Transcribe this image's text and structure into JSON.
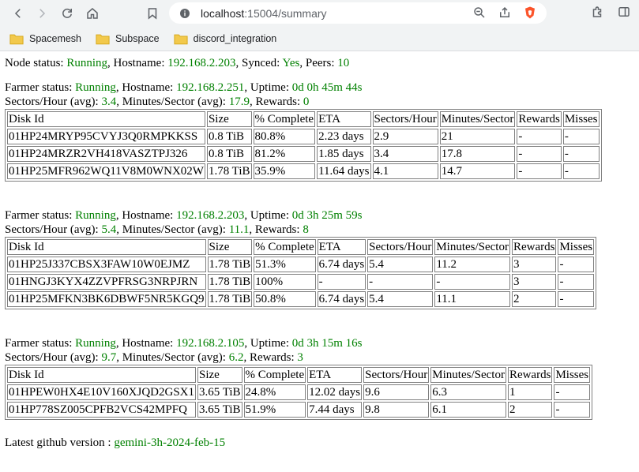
{
  "browser": {
    "url_host": "localhost",
    "url_path": ":15004/summary",
    "bookmarks": [
      "Spacemesh",
      "Subspace",
      "discord_integration"
    ]
  },
  "node": {
    "status_label": "Node status: ",
    "status": "Running",
    "hostname_label": ", Hostname: ",
    "hostname": "192.168.2.203",
    "synced_label": ", Synced: ",
    "synced": "Yes",
    "peers_label": ", Peers: ",
    "peers": "10"
  },
  "labels": {
    "farmer_status": "Farmer status: ",
    "hostname": ", Hostname: ",
    "uptime": ", Uptime: ",
    "sectors_hour": "Sectors/Hour (avg): ",
    "minutes_sector": ", Minutes/Sector (avg): ",
    "rewards": ", Rewards: ",
    "latest_version": "Latest github version : "
  },
  "columns": [
    "Disk Id",
    "Size",
    "% Complete",
    "ETA",
    "Sectors/Hour",
    "Minutes/Sector",
    "Rewards",
    "Misses"
  ],
  "farmers": [
    {
      "status": "Running",
      "hostname": "192.168.2.251",
      "uptime": "0d 0h 45m 44s",
      "sectors_hour": "3.4",
      "minutes_sector": "17.9",
      "rewards": "0",
      "disks": [
        [
          "01HP24MRYP95CVYJ3Q0RMPKKSS",
          "0.8 TiB",
          "80.8%",
          "2.23 days",
          "2.9",
          "21",
          "-",
          "-"
        ],
        [
          "01HP24MRZR2VH418VASZTPJ326",
          "0.8 TiB",
          "81.2%",
          "1.85 days",
          "3.4",
          "17.8",
          "-",
          "-"
        ],
        [
          "01HP25MFR962WQ11V8M0WNX02W",
          "1.78 TiB",
          "35.9%",
          "11.64 days",
          "4.1",
          "14.7",
          "-",
          "-"
        ]
      ]
    },
    {
      "status": "Running",
      "hostname": "192.168.2.203",
      "uptime": "0d 3h 25m 59s",
      "sectors_hour": "5.4",
      "minutes_sector": "11.1",
      "rewards": "8",
      "disks": [
        [
          "01HP25J337CBSX3FAW10W0EJMZ",
          "1.78 TiB",
          "51.3%",
          "6.74 days",
          "5.4",
          "11.2",
          "3",
          "-"
        ],
        [
          "01HNGJ3KYX4ZZVPFRSG3NRPJRN",
          "1.78 TiB",
          "100%",
          "-",
          "-",
          "-",
          "3",
          "-"
        ],
        [
          "01HP25MFKN3BK6DBWF5NR5KGQ9",
          "1.78 TiB",
          "50.8%",
          "6.74 days",
          "5.4",
          "11.1",
          "2",
          "-"
        ]
      ]
    },
    {
      "status": "Running",
      "hostname": "192.168.2.105",
      "uptime": "0d 3h 15m 16s",
      "sectors_hour": "9.7",
      "minutes_sector": "6.2",
      "rewards": "3",
      "disks": [
        [
          "01HPEW0HX4E10V160XJQD2GSX1",
          "3.65 TiB",
          "24.8%",
          "12.02 days",
          "9.6",
          "6.3",
          "1",
          "-"
        ],
        [
          "01HP778SZ005CPFB2VCS42MPFQ",
          "3.65 TiB",
          "51.9%",
          "7.44 days",
          "9.8",
          "6.1",
          "2",
          "-"
        ]
      ]
    }
  ],
  "latest_version": "gemini-3h-2024-feb-15",
  "colors": {
    "value": "#008000",
    "border": "#808080"
  }
}
